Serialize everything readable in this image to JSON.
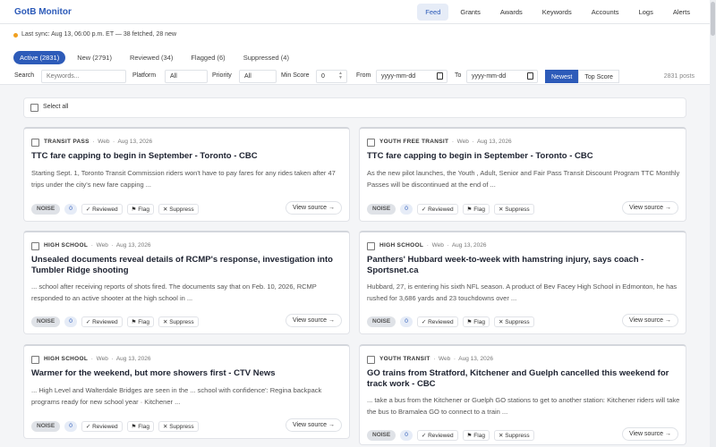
{
  "brand": "GotB Monitor",
  "nav": [
    "Feed",
    "Grants",
    "Awards",
    "Keywords",
    "Accounts",
    "Logs",
    "Alerts"
  ],
  "sync_text": "Last sync: Aug 13, 06:00 p.m. ET — 38 fetched, 28 new",
  "tabs": [
    "Active (2831)",
    "New (2791)",
    "Reviewed (34)",
    "Flagged (6)",
    "Suppressed (4)"
  ],
  "filters": {
    "search_label": "Search",
    "search_placeholder": "Keywords...",
    "platform_label": "Platform",
    "platform_value": "All",
    "priority_label": "Priority",
    "priority_value": "All",
    "minscore_label": "Min Score",
    "minscore_value": "0",
    "from_label": "From",
    "from_placeholder": "yyyy-mm-dd",
    "to_label": "To",
    "to_placeholder": "yyyy-mm-dd",
    "sort_newest": "Newest",
    "sort_top": "Top Score",
    "post_count": "2831 posts"
  },
  "select_all": "Select all",
  "card_common": {
    "noise": "NOISE",
    "reviewed": "✓ Reviewed",
    "flag": "⚑ Flag",
    "suppress": "✕ Suppress",
    "view_source": "View source →",
    "platform": "Web",
    "date": "Aug 13, 2026"
  },
  "cards": [
    {
      "tag": "TRANSIT PASS",
      "title": "TTC fare capping to begin in September - Toronto - CBC",
      "snippet": "Starting Sept. 1, Toronto Transit Commission riders won't have to pay fares for any rides taken after 47 trips under the city's new fare capping ...",
      "count": "0"
    },
    {
      "tag": "YOUTH FREE TRANSIT",
      "title": "TTC fare capping to begin in September - Toronto - CBC",
      "snippet": "As the new pilot launches, the Youth , Adult, Senior and Fair Pass Transit Discount Program TTC Monthly Passes will be discontinued at the end of ...",
      "count": "0"
    },
    {
      "tag": "HIGH SCHOOL",
      "title": "Unsealed documents reveal details of RCMP's response, investigation into Tumbler Ridge shooting",
      "snippet": "... school after receiving reports of shots fired. The documents say that on Feb. 10, 2026, RCMP responded to an active shooter at the high school in ...",
      "count": "0"
    },
    {
      "tag": "HIGH SCHOOL",
      "title": "Panthers' Hubbard week-to-week with hamstring injury, says coach - Sportsnet.ca",
      "snippet": "Hubbard, 27, is entering his sixth NFL season. A product of Bev Facey High School in Edmonton, he has rushed for 3,686 yards and 23 touchdowns over ...",
      "count": "0"
    },
    {
      "tag": "HIGH SCHOOL",
      "title": "Warmer for the weekend, but more showers first - CTV News",
      "snippet": "... High Level and Walterdale Bridges are seen in the ... school with confidence': Regina backpack programs ready for new school year · Kitchener ...",
      "count": "0"
    },
    {
      "tag": "YOUTH TRANSIT",
      "title": "GO trains from Stratford, Kitchener and Guelph cancelled this weekend for track work - CBC",
      "snippet": "... take a bus from the Kitchener or Guelph GO stations to get to another station: Kitchener riders will take the bus to Bramalea GO to connect to a train ...",
      "count": "0"
    }
  ]
}
